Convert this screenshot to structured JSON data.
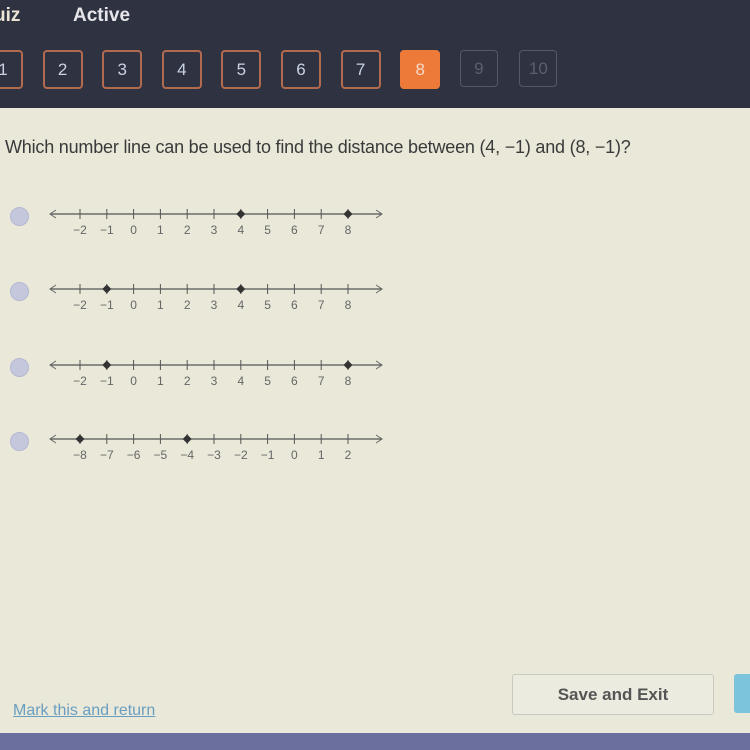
{
  "header": {
    "title": "Quiz",
    "title_visible": "uiz",
    "status": "Active"
  },
  "question_nav": [
    {
      "label": "1",
      "state": "visited"
    },
    {
      "label": "2",
      "state": "visited"
    },
    {
      "label": "3",
      "state": "visited"
    },
    {
      "label": "4",
      "state": "visited"
    },
    {
      "label": "5",
      "state": "visited"
    },
    {
      "label": "6",
      "state": "visited"
    },
    {
      "label": "7",
      "state": "visited"
    },
    {
      "label": "8",
      "state": "current"
    },
    {
      "label": "9",
      "state": "locked"
    },
    {
      "label": "10",
      "state": "locked"
    }
  ],
  "colors": {
    "current_accent": "#ed7a39",
    "header_bg": "#2f3241",
    "content_bg": "#e9e8d9",
    "link": "#6a9ec0",
    "next_button": "#7cc3dc",
    "bottom_bar": "#6b6f9e"
  },
  "question": {
    "text": "Which number line can be used to find the distance between (4, −1) and (8, −1)?"
  },
  "options": [
    {
      "ticks": [
        -2,
        -1,
        0,
        1,
        2,
        3,
        4,
        5,
        6,
        7,
        8
      ],
      "points": [
        4,
        8
      ],
      "selected": false
    },
    {
      "ticks": [
        -2,
        -1,
        0,
        1,
        2,
        3,
        4,
        5,
        6,
        7,
        8
      ],
      "points": [
        -1,
        4
      ],
      "selected": false
    },
    {
      "ticks": [
        -2,
        -1,
        0,
        1,
        2,
        3,
        4,
        5,
        6,
        7,
        8
      ],
      "points": [
        -1,
        8
      ],
      "selected": false
    },
    {
      "ticks": [
        -8,
        -7,
        -6,
        -5,
        -4,
        -3,
        -2,
        -1,
        0,
        1,
        2
      ],
      "points": [
        -8,
        -4
      ],
      "selected": false
    }
  ],
  "footer": {
    "mark_link": "Mark this and return",
    "save_exit": "Save and Exit"
  }
}
